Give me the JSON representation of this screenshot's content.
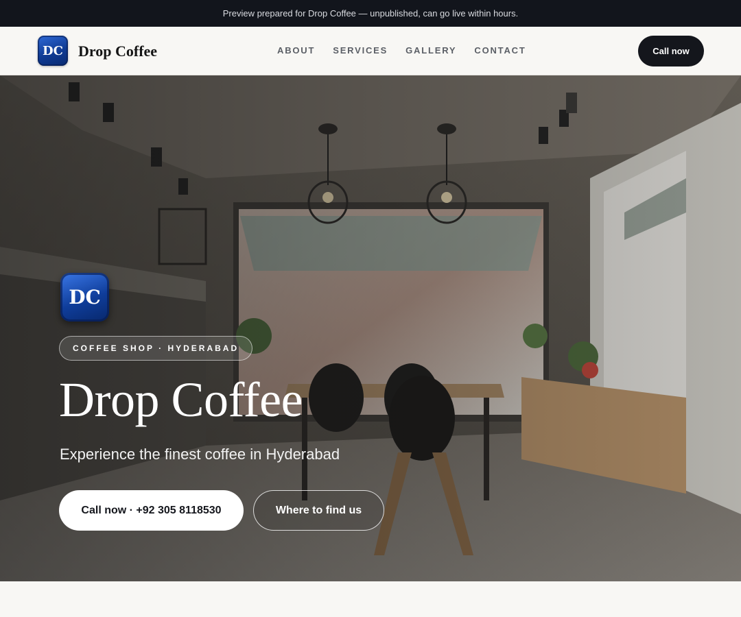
{
  "banner": {
    "text": "Preview prepared for Drop Coffee — unpublished, can go live within hours."
  },
  "nav": {
    "logo_initials": "DC",
    "brand": "Drop Coffee",
    "links": [
      "ABOUT",
      "SERVICES",
      "GALLERY",
      "CONTACT"
    ],
    "cta": "Call now"
  },
  "hero": {
    "logo_initials": "DC",
    "tag": "COFFEE SHOP · HYDERABAD",
    "title": "Drop Coffee",
    "subtitle": "Experience the finest coffee in Hyderabad",
    "primary_button": "Call now · +92 305 8118530",
    "secondary_button": "Where to find us"
  },
  "colors": {
    "banner_bg": "#12151c",
    "page_bg": "#f8f7f4",
    "cta_bg": "#14161c",
    "logo_blue": "#0f3d9a"
  }
}
